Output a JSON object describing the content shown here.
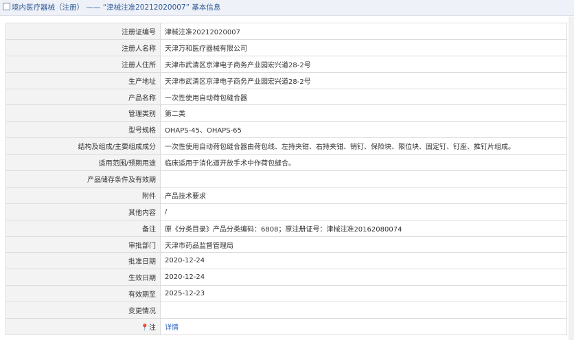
{
  "header": {
    "prefix": "境内医疗器械（注册）",
    "separator": "——",
    "record_title": "“津械注准20212020007”",
    "suffix": "基本信息"
  },
  "rows": [
    {
      "label": "注册证编号",
      "value": "津械注准20212020007"
    },
    {
      "label": "注册人名称",
      "value": "天津万和医疗器械有限公司"
    },
    {
      "label": "注册人住所",
      "value": "天津市武清区京津电子商务产业园宏兴道28-2号"
    },
    {
      "label": "生产地址",
      "value": "天津市武清区京津电子商务产业园宏兴道28-2号"
    },
    {
      "label": "产品名称",
      "value": "一次性使用自动荷包缝合器"
    },
    {
      "label": "管理类别",
      "value": "第二类"
    },
    {
      "label": "型号规格",
      "value": "OHAPS-45、OHAPS-65"
    },
    {
      "label": "结构及组成/主要组成成分",
      "value": "一次性使用自动荷包缝合器由荷包线、左持夹钳、右持夹钳、销钉、保险块、限位块、固定钉、钉座、推钉片组成。"
    },
    {
      "label": "适用范围/预期用途",
      "value": "临床适用于消化道开放手术中作荷包缝合。"
    },
    {
      "label": "产品储存条件及有效期",
      "value": ""
    },
    {
      "label": "附件",
      "value": "产品技术要求"
    },
    {
      "label": "其他内容",
      "value": "/"
    },
    {
      "label": "备注",
      "value": "原《分类目录》产品分类编码：6808；原注册证号：津械注准20162080074"
    },
    {
      "label": "审批部门",
      "value": "天津市药品监督管理局"
    },
    {
      "label": "批准日期",
      "value": "2020-12-24"
    },
    {
      "label": "生效日期",
      "value": "2020-12-24"
    },
    {
      "label": "有效期至",
      "value": "2025-12-23"
    },
    {
      "label": "变更情况",
      "value": ""
    }
  ],
  "note_row": {
    "label": "注",
    "icon": "pin-icon",
    "link": "详情"
  }
}
